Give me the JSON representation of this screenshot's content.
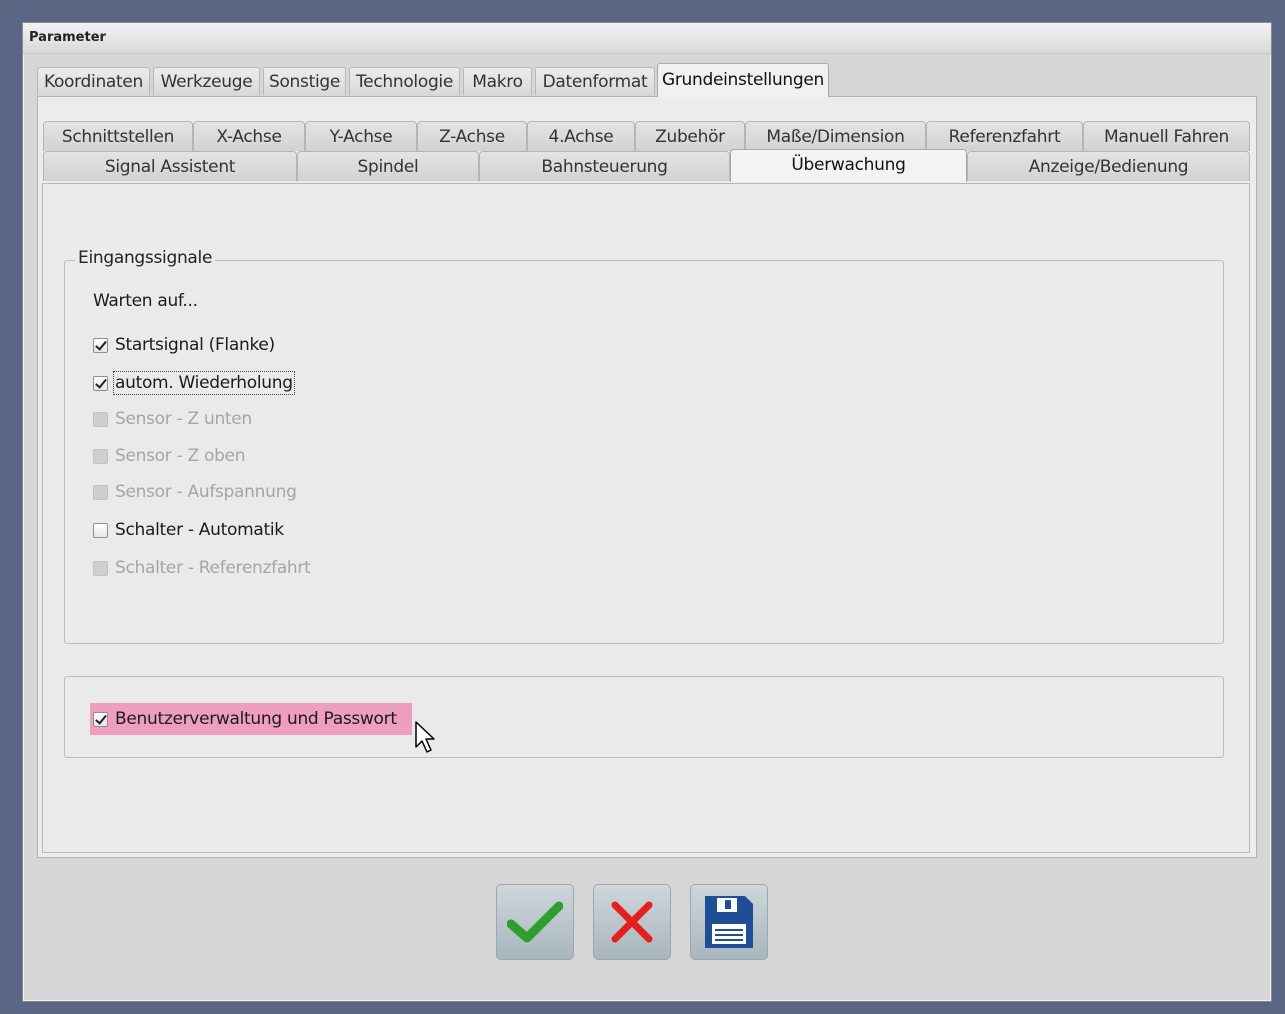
{
  "window": {
    "title": "Parameter"
  },
  "outer_tabs": [
    {
      "label": "Koordinaten"
    },
    {
      "label": "Werkzeuge"
    },
    {
      "label": "Sonstige"
    },
    {
      "label": "Technologie"
    },
    {
      "label": "Makro"
    },
    {
      "label": "Datenformat"
    },
    {
      "label": "Grundeinstellungen",
      "active": true
    }
  ],
  "inner_tabs_row1": [
    {
      "label": "Schnittstellen"
    },
    {
      "label": "X-Achse"
    },
    {
      "label": "Y-Achse"
    },
    {
      "label": "Z-Achse"
    },
    {
      "label": "4.Achse"
    },
    {
      "label": "Zubehör"
    },
    {
      "label": "Maße/Dimension"
    },
    {
      "label": "Referenzfahrt"
    },
    {
      "label": "Manuell Fahren"
    }
  ],
  "inner_tabs_row2": [
    {
      "label": "Signal Assistent"
    },
    {
      "label": "Spindel"
    },
    {
      "label": "Bahnsteuerung"
    },
    {
      "label": "Überwachung",
      "active": true
    },
    {
      "label": "Anzeige/Bedienung"
    }
  ],
  "input_signals": {
    "group_title": "Eingangssignale",
    "wait_label": "Warten auf...",
    "options": [
      {
        "label": "Startsignal (Flanke)",
        "checked": true,
        "enabled": true
      },
      {
        "label": "autom. Wiederholung",
        "checked": true,
        "enabled": true,
        "focused": true
      },
      {
        "label": "Sensor - Z unten",
        "checked": false,
        "enabled": false
      },
      {
        "label": "Sensor - Z oben",
        "checked": false,
        "enabled": false
      },
      {
        "label": "Sensor - Aufspannung",
        "checked": false,
        "enabled": false
      },
      {
        "label": "Schalter - Automatik",
        "checked": false,
        "enabled": true
      },
      {
        "label": "Schalter - Referenzfahrt",
        "checked": false,
        "enabled": false
      }
    ]
  },
  "user_management": {
    "label": "Benutzerverwaltung und Passwort",
    "checked": true,
    "highlight_color": "#ee9fbf"
  },
  "buttons": {
    "ok": {
      "icon": "checkmark-icon",
      "color": "#2e9e2e"
    },
    "cancel": {
      "icon": "x-icon",
      "color": "#e41f1f"
    },
    "save": {
      "icon": "floppy-disk-icon",
      "color": "#1f4e96"
    }
  }
}
